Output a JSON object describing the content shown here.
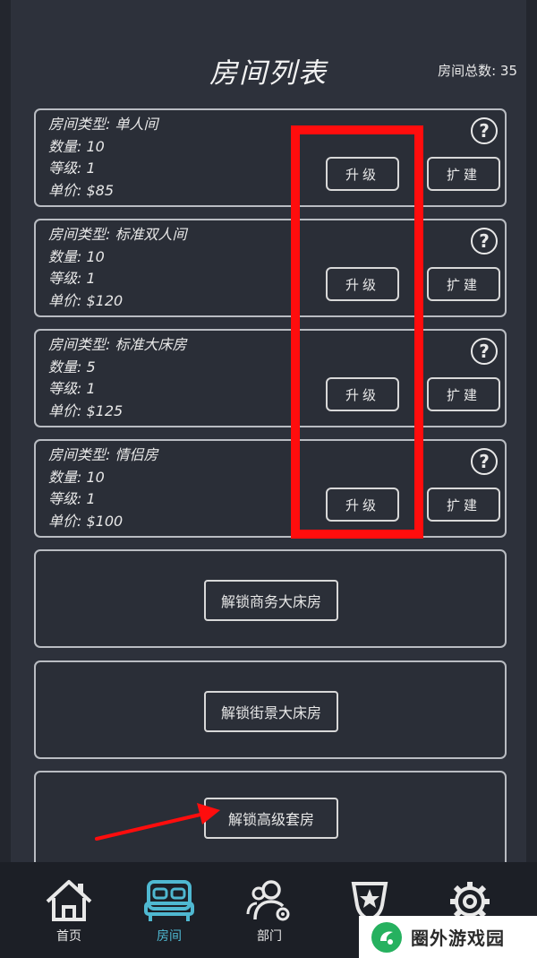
{
  "header": {
    "title": "房间列表",
    "total_label": "房间总数: 35"
  },
  "rooms": [
    {
      "type": "房间类型: 单人间",
      "count": "数量: 10",
      "level": "等级: 1",
      "price": "单价: $85",
      "upgrade_label": "升级",
      "expand_label": "扩建"
    },
    {
      "type": "房间类型: 标准双人间",
      "count": "数量: 10",
      "level": "等级: 1",
      "price": "单价: $120",
      "upgrade_label": "升级",
      "expand_label": "扩建"
    },
    {
      "type": "房间类型: 标准大床房",
      "count": "数量: 5",
      "level": "等级: 1",
      "price": "单价: $125",
      "upgrade_label": "升级",
      "expand_label": "扩建"
    },
    {
      "type": "房间类型: 情侣房",
      "count": "数量: 10",
      "level": "等级: 1",
      "price": "单价: $100",
      "upgrade_label": "升级",
      "expand_label": "扩建"
    }
  ],
  "help_glyph": "?",
  "unlock": [
    {
      "label": "解锁商务大床房"
    },
    {
      "label": "解锁街景大床房"
    },
    {
      "label": "解锁高级套房"
    }
  ],
  "tabs": [
    {
      "label": "首页",
      "icon": "home-icon"
    },
    {
      "label": "房间",
      "icon": "bed-icon",
      "active": true
    },
    {
      "label": "部门",
      "icon": "users-gear-icon"
    },
    {
      "label": "",
      "icon": "star-badge-icon"
    },
    {
      "label": "",
      "icon": "gear-icon"
    }
  ],
  "watermark": {
    "text": "圈外游戏园"
  },
  "colors": {
    "background": "#2d313b",
    "card_border": "#b9bcc2",
    "highlight": "#ff0d0d",
    "active_tab": "#4fb8d1",
    "tab_bar": "#1c1f26",
    "watermark_green": "#26b15f"
  }
}
